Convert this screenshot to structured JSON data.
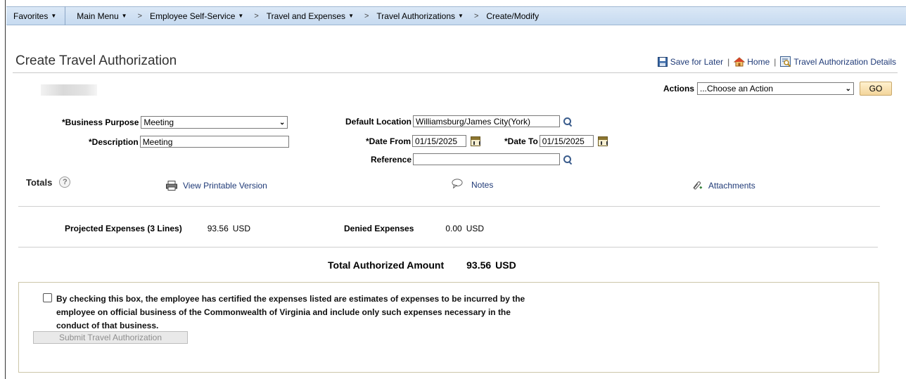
{
  "navbar": {
    "favorites": "Favorites",
    "main_menu": "Main Menu",
    "breadcrumbs": [
      "Employee Self-Service",
      "Travel and Expenses",
      "Travel Authorizations",
      "Create/Modify"
    ]
  },
  "page": {
    "title": "Create Travel Authorization"
  },
  "header_links": {
    "save_for_later": "Save for Later",
    "home": "Home",
    "details": "Travel Authorization Details",
    "separator": "|"
  },
  "actions": {
    "label": "Actions",
    "selected": "...Choose an Action",
    "go": "GO"
  },
  "form": {
    "business_purpose_label": "*Business Purpose",
    "business_purpose_value": "Meeting",
    "description_label": "*Description",
    "description_value": "Meeting",
    "default_location_label": "Default Location",
    "default_location_value": "Williamsburg/James City(York)",
    "date_from_label": "*Date From",
    "date_from_value": "01/15/2025",
    "date_to_label": "*Date To",
    "date_to_value": "01/15/2025",
    "reference_label": "Reference",
    "reference_value": ""
  },
  "totals": {
    "label": "Totals",
    "help": "?",
    "view_printable": "View Printable Version",
    "notes": "Notes",
    "attachments": "Attachments"
  },
  "summary": {
    "projected_label": "Projected Expenses (3 Lines)",
    "projected_value": "93.56",
    "projected_currency": "USD",
    "denied_label": "Denied Expenses",
    "denied_value": "0.00",
    "denied_currency": "USD",
    "total_label": "Total Authorized Amount",
    "total_value": "93.56",
    "total_currency": "USD"
  },
  "certification": {
    "text": "By checking this box, the employee has certified the expenses listed are estimates of expenses to be incurred by the employee on official business of the Commonwealth of Virginia and include only such expenses necessary in the conduct of that business.",
    "checked": false,
    "submit_label": "Submit Travel Authorization"
  }
}
